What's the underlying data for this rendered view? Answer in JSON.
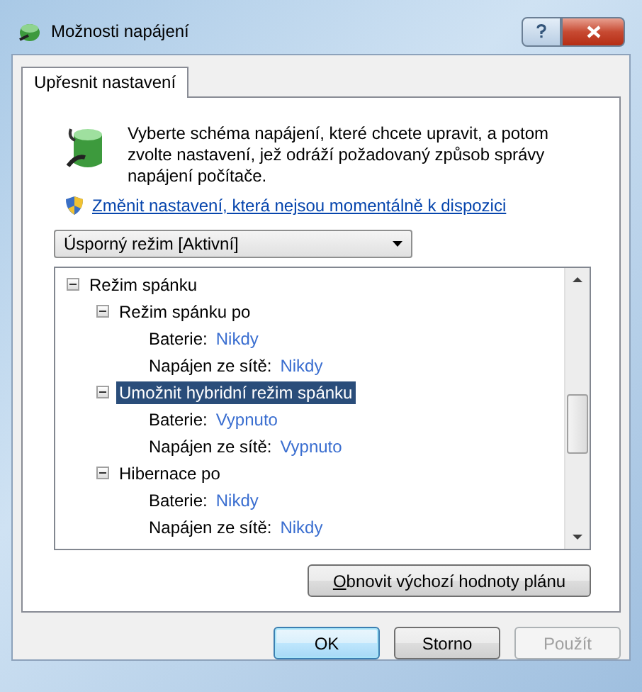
{
  "window": {
    "title": "Možnosti napájení"
  },
  "tabs": [
    {
      "label": "Upřesnit nastavení",
      "selected": true
    }
  ],
  "intro": "Vyberte schéma napájení, které chcete upravit, a potom zvolte nastavení, jež odráží požadovaný způsob správy napájení počítače.",
  "link": "Změnit nastavení, která nejsou momentálně k dispozici",
  "plan_dropdown": {
    "value": "Úsporný režim [Aktivní]"
  },
  "tree": [
    {
      "label": "Režim spánku",
      "expanded": true,
      "selected": false,
      "children": [
        {
          "label": "Režim spánku po",
          "expanded": true,
          "selected": false,
          "children": [
            {
              "label": "Baterie:",
              "value": "Nikdy",
              "selected": false
            },
            {
              "label": "Napájen ze sítě:",
              "value": "Nikdy",
              "selected": false
            }
          ]
        },
        {
          "label": "Umožnit hybridní režim spánku",
          "expanded": true,
          "selected": true,
          "children": [
            {
              "label": "Baterie:",
              "value": "Vypnuto",
              "selected": false
            },
            {
              "label": "Napájen ze sítě:",
              "value": "Vypnuto",
              "selected": false
            }
          ]
        },
        {
          "label": "Hibernace po",
          "expanded": true,
          "selected": false,
          "children": [
            {
              "label": "Baterie:",
              "value": "Nikdy",
              "selected": false
            },
            {
              "label": "Napájen ze sítě:",
              "value": "Nikdy",
              "selected": false
            }
          ]
        }
      ]
    }
  ],
  "reset_button": "Obnovit výchozí hodnoty plánu",
  "buttons": [
    {
      "label": "OK",
      "default": true,
      "disabled": false
    },
    {
      "label": "Storno",
      "default": false,
      "disabled": false
    },
    {
      "label": "Použít",
      "default": false,
      "disabled": true
    }
  ]
}
